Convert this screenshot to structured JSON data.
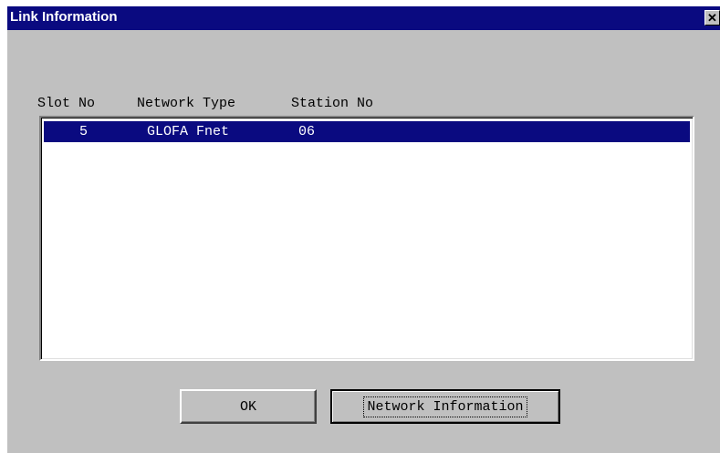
{
  "window": {
    "title": "Link Information",
    "close_glyph": "✕"
  },
  "list": {
    "columns": [
      "Slot No",
      "Network Type",
      "Station No"
    ],
    "rows": [
      {
        "slot_no": "5",
        "network_type": "GLOFA Fnet",
        "station_no": "06",
        "selected": true
      }
    ]
  },
  "buttons": {
    "ok_label": "OK",
    "network_info_label": "Network Information"
  },
  "colors": {
    "titlebar": "#0a0a80",
    "selection": "#0a0a80",
    "dialog_face": "#c0c0c0"
  }
}
